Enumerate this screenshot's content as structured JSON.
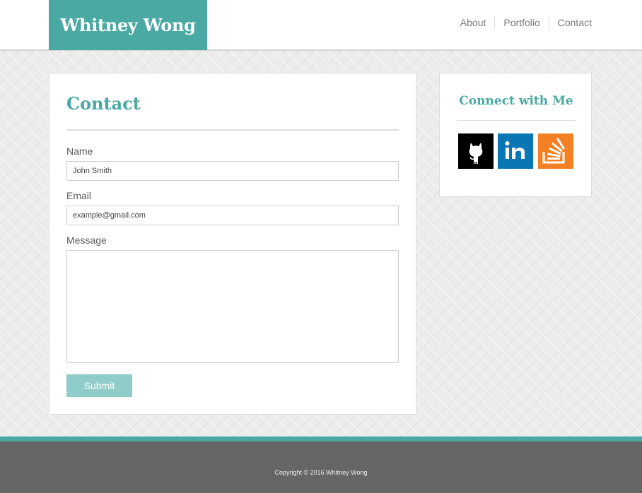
{
  "header": {
    "brand": "Whitney Wong",
    "nav": [
      "About",
      "Portfolio",
      "Contact"
    ]
  },
  "contact": {
    "title": "Contact",
    "name_label": "Name",
    "name_value": "John Smith",
    "email_label": "Email",
    "email_value": "example@gmail.com",
    "message_label": "Message",
    "message_value": "",
    "submit_label": "Submit"
  },
  "social": {
    "title": "Connect with Me",
    "icons": [
      "github-icon",
      "linkedin-icon",
      "stackoverflow-icon"
    ]
  },
  "footer": {
    "copyright": "Copyright © 2016 Whitney Wong"
  },
  "colors": {
    "accent": "#4aa9a2",
    "submit": "#91cdc8",
    "footer_bg": "#666666",
    "github": "#000000",
    "linkedin": "#0a77b5",
    "stackoverflow": "#f48024"
  }
}
